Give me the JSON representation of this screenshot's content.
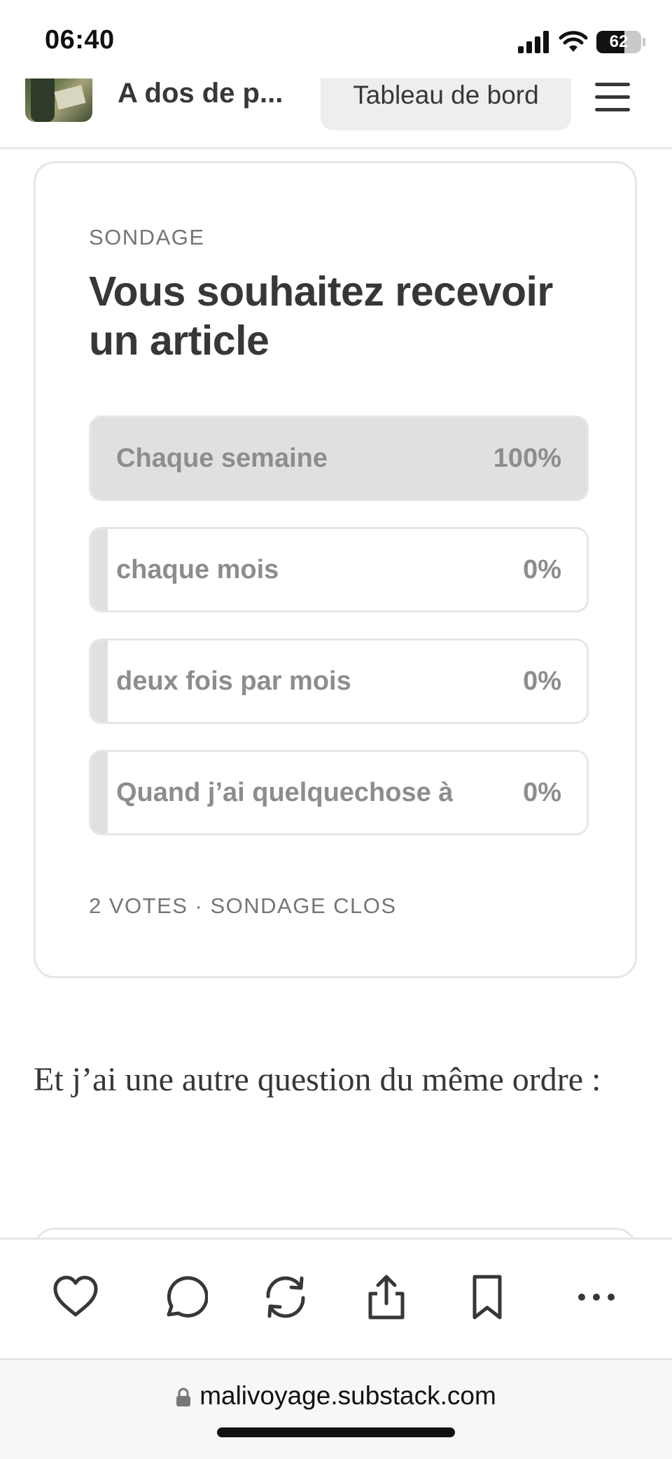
{
  "status_bar": {
    "time": "06:40",
    "battery": "62",
    "battery_level_percent": 62
  },
  "header": {
    "publication_name": "A dos de p...",
    "dashboard_label": "Tableau de bord"
  },
  "poll": {
    "kicker": "SONDAGE",
    "question": "Vous souhaitez recevoir un article",
    "options": [
      {
        "label": "Chaque semaine",
        "percent": "100%",
        "share": 100
      },
      {
        "label": "chaque mois",
        "percent": "0%",
        "share": 0
      },
      {
        "label": "deux fois par mois",
        "percent": "0%",
        "share": 0
      },
      {
        "label": "Quand j’ai quelquechose à",
        "percent": "0%",
        "share": 0
      }
    ],
    "footer": "2 VOTES · SONDAGE CLOS"
  },
  "article": {
    "paragraph": "Et j’ai une autre question du même ordre :"
  },
  "action_bar": {
    "icons": [
      "heart-icon",
      "comment-icon",
      "restack-icon",
      "share-icon",
      "bookmark-icon",
      "more-icon"
    ]
  },
  "url_bar": {
    "url": "malivoyage.substack.com"
  }
}
